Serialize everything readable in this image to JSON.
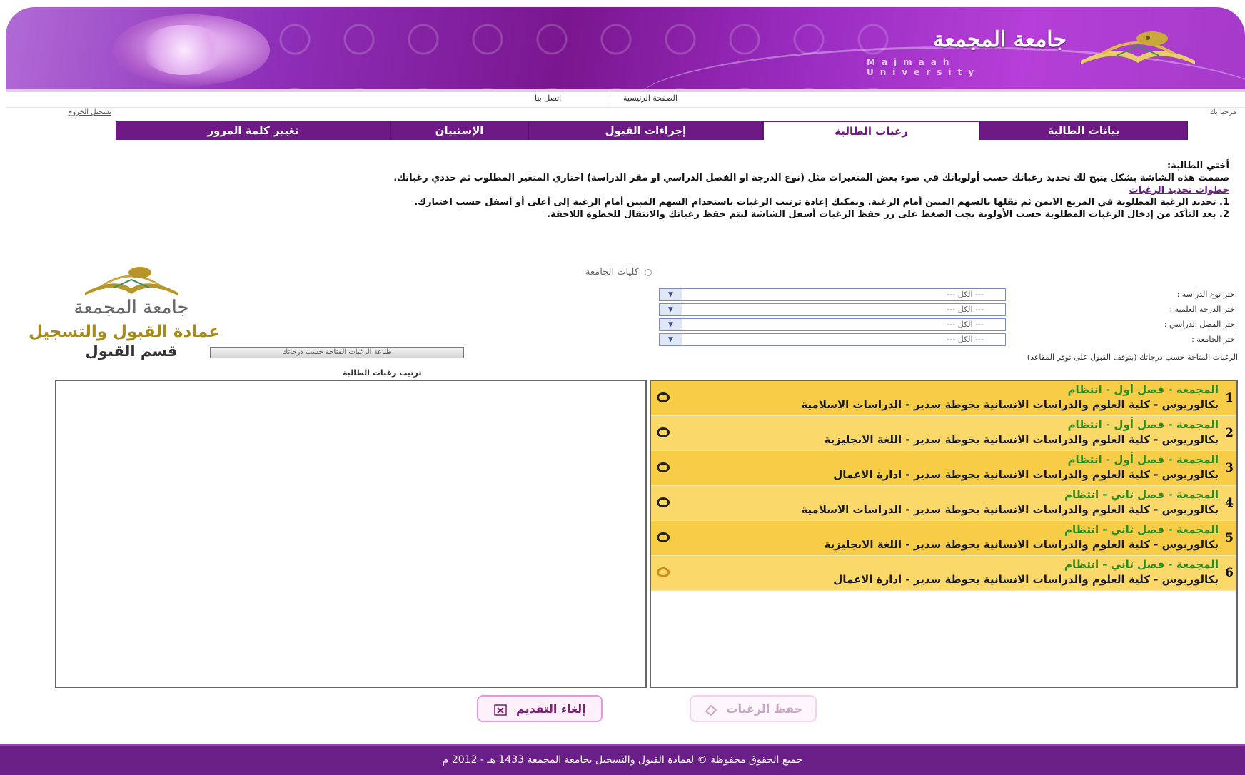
{
  "header": {
    "university_ar": "جامعة المجمعة",
    "university_en": "Majmaah University"
  },
  "topnav": {
    "home": "الصفحة الرئيسية",
    "contact": "اتصل بنا"
  },
  "welcome": "مرحبا بك",
  "logout": "تسجيل الخروج",
  "tabs": [
    {
      "label": "بيانات الطالبة",
      "active": false
    },
    {
      "label": "رغبات الطالبة",
      "active": true
    },
    {
      "label": "إجراءات القبول",
      "active": false
    },
    {
      "label": "الإستبيان",
      "active": false
    },
    {
      "label": "تغيير كلمة المرور",
      "active": false
    }
  ],
  "instructions": {
    "greeting": "أختي الطالبة:",
    "intro": "صممت هذه الشاشة بشكل يتيح لك تحديد رغباتك حسب أولوياتك في ضوء بعض المتغيرات مثل (نوع الدرجة او الفصل الدراسي او مقر الدراسة) اختاري المتغير المطلوب ثم حددي رغباتك.",
    "steps_title": "خطوات تحديد الرغبات",
    "step1": "1. تحديد الرغبة المطلوبة في المربع الايمن ثم نقلها بالسهم المبين أمام الرغبة. ويمكنك إعادة ترتيب الرغبات باستخدام السهم المبين أمام الرغبة إلى أعلى أو أسفل حسب اختيارك.",
    "step2": "2. بعد التأكد من إدخال الرغبات المطلوبة حسب الأولوية يجب الضغط على زر حفظ الرغبات أسفل الشاشة ليتم حفظ رغباتك والانتقال للخطوة اللاحقة."
  },
  "colleges_radio": "كليات الجامعة",
  "filters": [
    {
      "label": "اختر نوع الدراسة :",
      "value": "--- الكل ---"
    },
    {
      "label": "اختر الدرجة العلمية :",
      "value": "--- الكل ---"
    },
    {
      "label": "اختر الفصل الدراسي :",
      "value": "--- الكل ---"
    },
    {
      "label": "اختر الجامعة :",
      "value": "--- الكل ---"
    }
  ],
  "available_label": "الرغبات المتاحة حسب درجاتك (بتوقف القبول على توفر المقاعد)",
  "logo_block": {
    "university": "جامعة المجمعة",
    "deanship": "عمادة القبول والتسجيل",
    "department": "قسم القبول"
  },
  "print_button": "طباعة الرغبات المتاحة حسب درجاتك",
  "rank_label": "ترتيب رغبات الطالبة",
  "available_wishes": [
    {
      "num": "1",
      "line1": "المجمعة - فصل أول - انتظام",
      "line2": "بكالوريوس - كلية العلوم والدراسات الانسانية بحوطة سدير - الدراسات الاسلامية"
    },
    {
      "num": "2",
      "line1": "المجمعة - فصل أول - انتظام",
      "line2": "بكالوريوس - كلية العلوم والدراسات الانسانية بحوطة سدير - اللغة الانجليزية"
    },
    {
      "num": "3",
      "line1": "المجمعة - فصل أول - انتظام",
      "line2": "بكالوريوس - كلية العلوم والدراسات الانسانية بحوطة سدير - ادارة الاعمال"
    },
    {
      "num": "4",
      "line1": "المجمعة - فصل ثاني - انتظام",
      "line2": "بكالوريوس - كلية العلوم والدراسات الانسانية بحوطة سدير - الدراسات الاسلامية"
    },
    {
      "num": "5",
      "line1": "المجمعة - فصل ثاني - انتظام",
      "line2": "بكالوريوس - كلية العلوم والدراسات الانسانية بحوطة سدير - اللغة الانجليزية"
    },
    {
      "num": "6",
      "line1": "المجمعة - فصل ثاني - انتظام",
      "line2": "بكالوريوس - كلية العلوم والدراسات الانسانية بحوطة سدير - ادارة الاعمال"
    }
  ],
  "buttons": {
    "save": "حفظ الرغبات",
    "cancel": "إلغاء التقديم"
  },
  "footer": "جميع الحقوق محفوظة © لعمادة القبول والتسجيل بجامعة المجمعة 1433 هـ - 2012 م",
  "colors": {
    "brand_purple": "#6d1a85",
    "wish_yellow": "#f7cd48",
    "wish_green": "#2e8b20"
  }
}
